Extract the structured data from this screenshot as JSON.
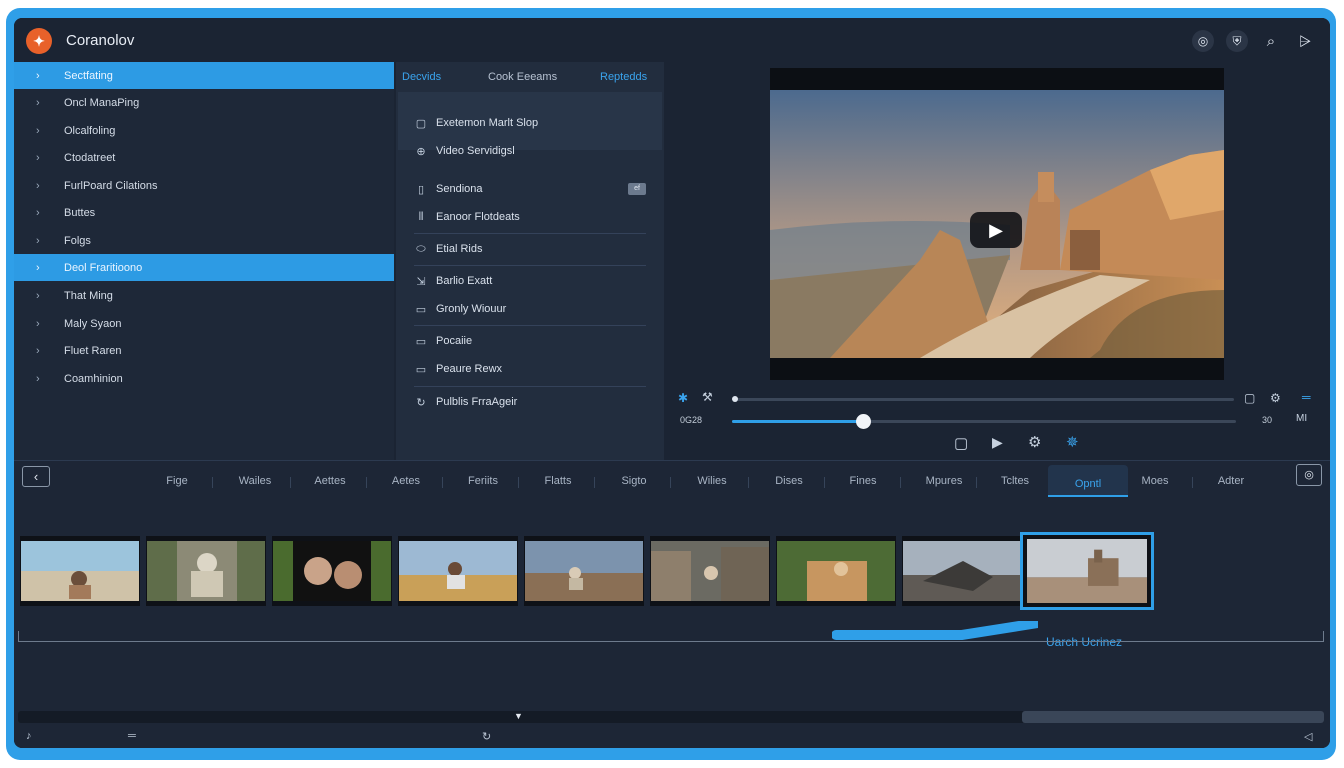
{
  "app": {
    "title": "Coranolov"
  },
  "titlebar": {
    "icons": [
      "record-icon",
      "shield-icon",
      "search-icon",
      "filter-icon"
    ]
  },
  "sidebar": {
    "items": [
      {
        "label": "Sectfating",
        "active": true
      },
      {
        "label": "Oncl ManaPing",
        "active": false
      },
      {
        "label": "Olcalfoling",
        "active": false
      },
      {
        "label": "Ctodatreet",
        "active": false
      },
      {
        "label": "FurlPoard Cilations",
        "active": false
      },
      {
        "label": "Buttes",
        "active": false
      },
      {
        "label": "Folgs",
        "active": false
      },
      {
        "label": "Deol Fraritioono",
        "active": true
      },
      {
        "label": "That Ming",
        "active": false
      },
      {
        "label": "Maly Syaon",
        "active": false
      },
      {
        "label": "Fluet Raren",
        "active": false
      },
      {
        "label": "Coamhinion",
        "active": false
      }
    ]
  },
  "midpanel": {
    "tabs": [
      "Decvids",
      "Cook Eeeams",
      "Reptedds"
    ],
    "items": [
      {
        "label": "Exetemon Marlt Slop",
        "icon": "checkbox-icon"
      },
      {
        "label": "Video Servidigsl",
        "icon": "globe-icon"
      },
      {
        "label": "Sendiona",
        "icon": "document-icon",
        "badge": "ef"
      },
      {
        "label": "Eanoor Flotdeats",
        "icon": "equalizer-icon"
      },
      {
        "label": "Etial Rids",
        "icon": "loop-icon"
      },
      {
        "label": "Barlio Exatt",
        "icon": "export-icon"
      },
      {
        "label": "Gronly Wiouur",
        "icon": "folder-icon"
      },
      {
        "label": "Pocaiie",
        "icon": "folder-icon"
      },
      {
        "label": "Peaure Rewx",
        "icon": "folder-icon"
      },
      {
        "label": "Pulblis FrraAgeir",
        "icon": "refresh-icon"
      }
    ]
  },
  "player": {
    "time_current": "0G28",
    "time_end": "30",
    "seek_progress": 0.26,
    "end_icon": "MI",
    "controls": [
      "stop-icon",
      "step-forward-icon",
      "settings-icon",
      "effects-icon"
    ]
  },
  "timeline": {
    "tabs": [
      "Fige",
      "Wailes",
      "Aettes",
      "Aetes",
      "Feriits",
      "Flatts",
      "Sigto",
      "Wilies",
      "Dises",
      "Fines",
      "Mpures",
      "Tcltes",
      "Opntl",
      "Moes",
      "Adter"
    ],
    "active_tab": 12,
    "selected_clip_label": "Uarch Ucrinez"
  },
  "colors": {
    "accent": "#2f9fe8",
    "background": "#1b2433",
    "frame": "#2f9fe8"
  }
}
